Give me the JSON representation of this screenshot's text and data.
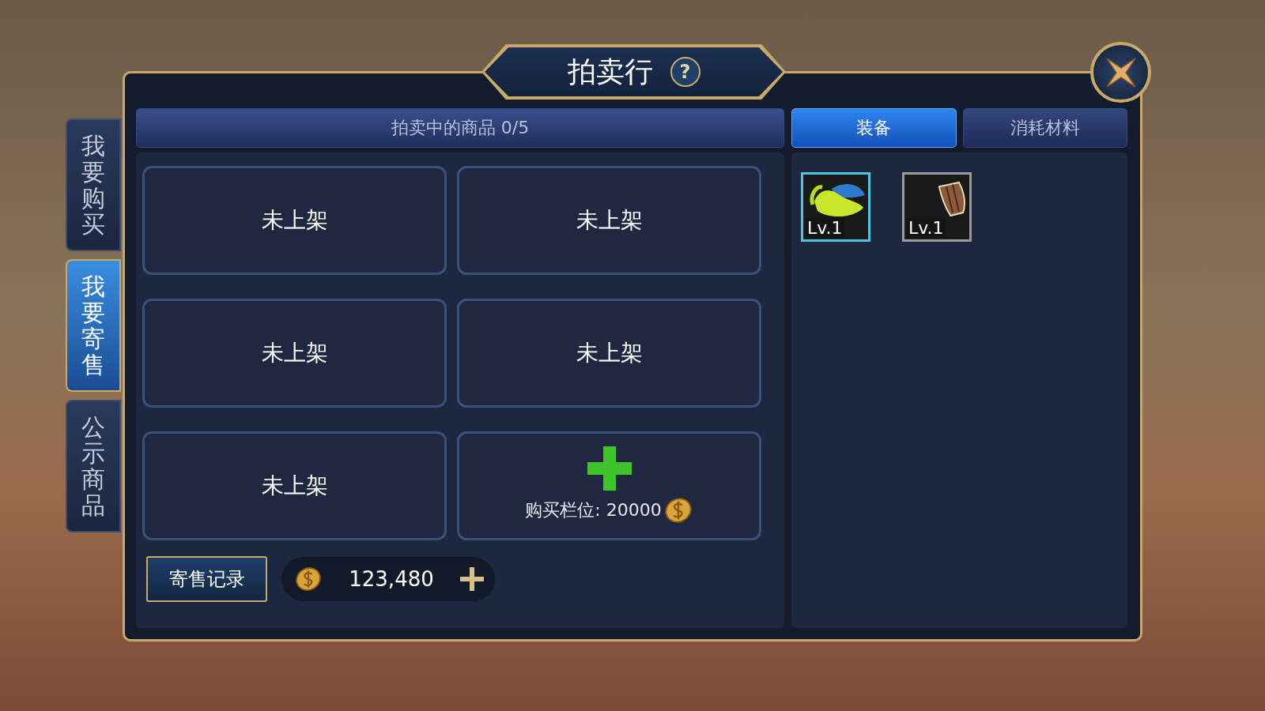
{
  "title": "拍卖行",
  "help": "?",
  "side_tabs": [
    {
      "label": "我要购买",
      "selected": false
    },
    {
      "label": "我要寄售",
      "selected": true
    },
    {
      "label": "公示商品",
      "selected": false
    }
  ],
  "listing_bar": {
    "label": "拍卖中的商品 0/5"
  },
  "category_tabs": [
    {
      "label": "装备",
      "selected": true
    },
    {
      "label": "消耗材料",
      "selected": false
    }
  ],
  "slots": [
    {
      "kind": "empty",
      "label": "未上架"
    },
    {
      "kind": "empty",
      "label": "未上架"
    },
    {
      "kind": "empty",
      "label": "未上架"
    },
    {
      "kind": "empty",
      "label": "未上架"
    },
    {
      "kind": "empty",
      "label": "未上架"
    },
    {
      "kind": "buy",
      "label": "购买栏位: 20000"
    }
  ],
  "history_button": "寄售记录",
  "gold": "123,480",
  "inventory": [
    {
      "kind": "helmet",
      "level": "Lv.1",
      "color": "#4cc3e0"
    },
    {
      "kind": "shield",
      "level": "Lv.1",
      "color": "#9a9a9a"
    }
  ]
}
